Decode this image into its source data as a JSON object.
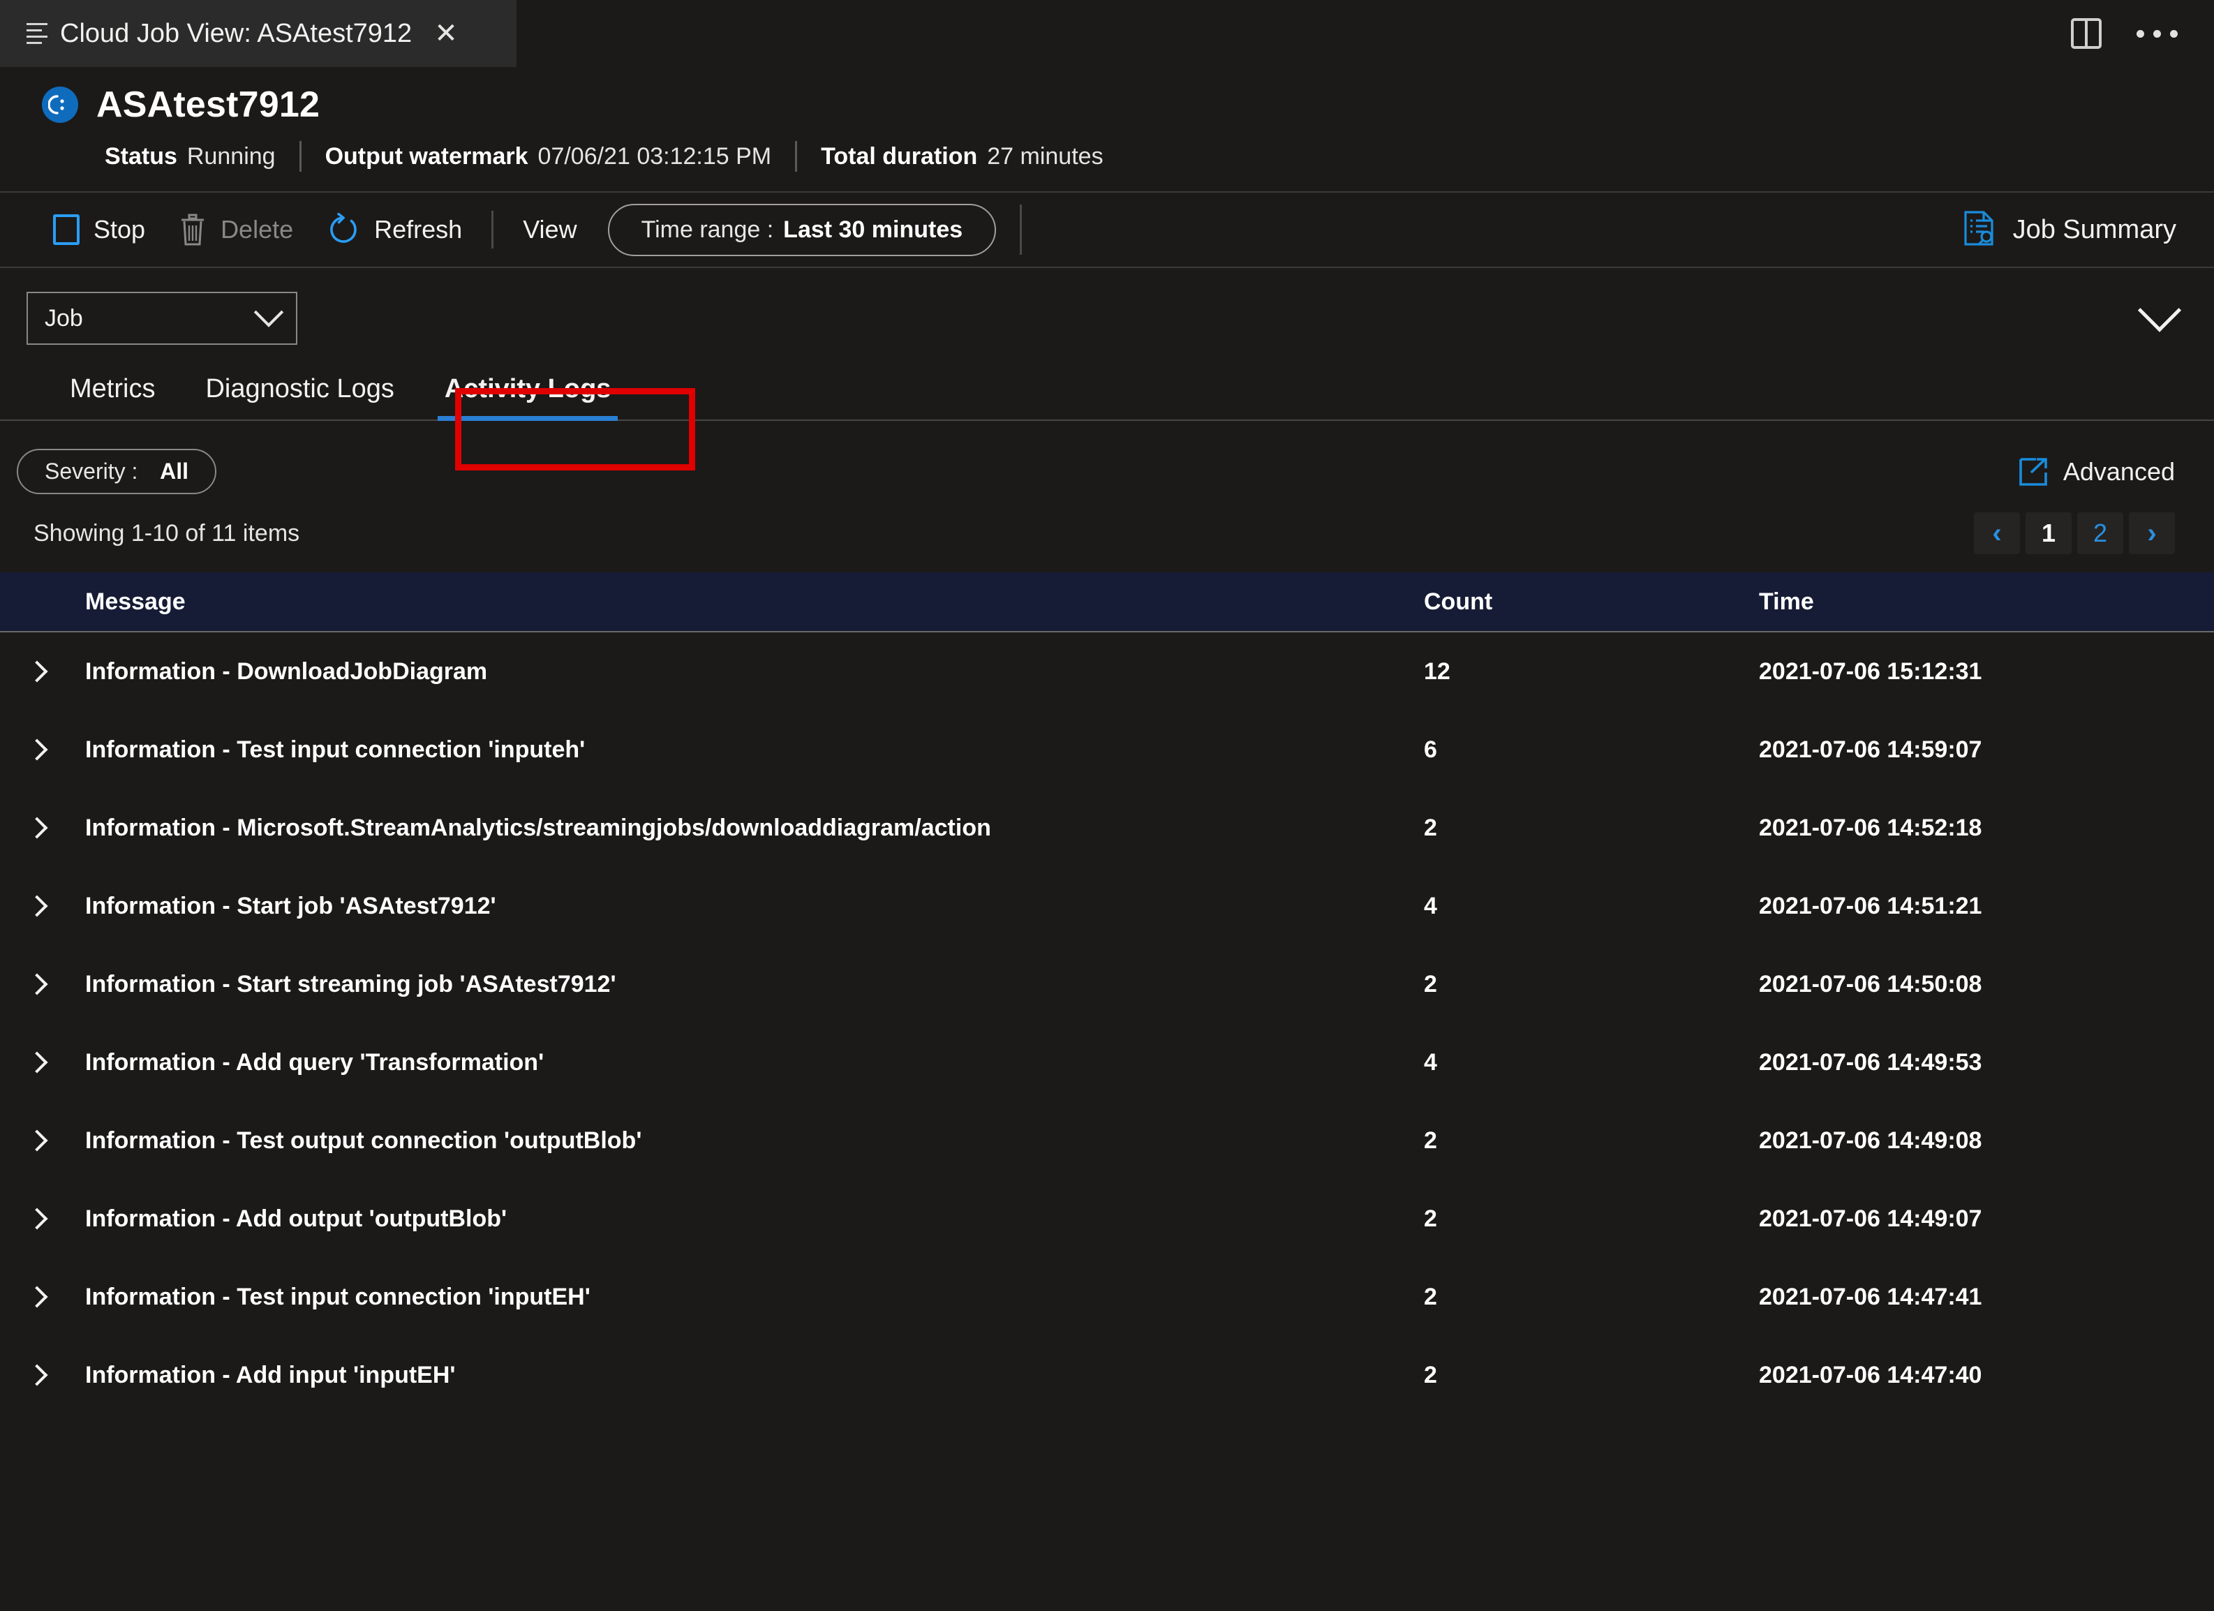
{
  "tabstrip": {
    "tab_title": "Cloud Job View: ASAtest7912",
    "close_label": "✕",
    "menu_icon": "hamburger-icon",
    "split_icon": "split-view-icon",
    "more_icon": "ellipsis-icon"
  },
  "job": {
    "name": "ASAtest7912",
    "status_key": "Status",
    "status_value": "Running",
    "watermark_key": "Output watermark",
    "watermark_value": "07/06/21 03:12:15 PM",
    "duration_key": "Total duration",
    "duration_value": "27 minutes"
  },
  "toolbar": {
    "stop_label": "Stop",
    "delete_label": "Delete",
    "refresh_label": "Refresh",
    "view_label": "View",
    "time_range_key": "Time range :",
    "time_range_value": "Last 30 minutes",
    "job_summary_label": "Job Summary"
  },
  "selector": {
    "scope_value": "Job",
    "collapse_icon": "chevron-down-icon"
  },
  "tabs": {
    "items": [
      {
        "label": "Metrics",
        "active": false
      },
      {
        "label": "Diagnostic Logs",
        "active": false
      },
      {
        "label": "Activity Logs",
        "active": true
      }
    ],
    "highlight_color": "#e00000",
    "active_underline_color": "#2a7fd4"
  },
  "filters": {
    "severity_key": "Severity :",
    "severity_value": "All",
    "advanced_label": "Advanced"
  },
  "results": {
    "showing_text": "Showing 1-10 of 11 items",
    "pager": {
      "prev_label": "‹",
      "next_label": "›",
      "pages": [
        "1",
        "2"
      ],
      "current_page": "1"
    }
  },
  "table": {
    "columns": [
      "Message",
      "Count",
      "Time"
    ],
    "header_bg": "#161c35",
    "rows": [
      {
        "message": "Information - DownloadJobDiagram",
        "count": "12",
        "time": "2021-07-06 15:12:31"
      },
      {
        "message": "Information - Test input connection 'inputeh'",
        "count": "6",
        "time": "2021-07-06 14:59:07"
      },
      {
        "message": "Information - Microsoft.StreamAnalytics/streamingjobs/downloaddiagram/action",
        "count": "2",
        "time": "2021-07-06 14:52:18"
      },
      {
        "message": "Information - Start job 'ASAtest7912'",
        "count": "4",
        "time": "2021-07-06 14:51:21"
      },
      {
        "message": "Information - Start streaming job 'ASAtest7912'",
        "count": "2",
        "time": "2021-07-06 14:50:08"
      },
      {
        "message": "Information - Add query 'Transformation'",
        "count": "4",
        "time": "2021-07-06 14:49:53"
      },
      {
        "message": "Information - Test output connection 'outputBlob'",
        "count": "2",
        "time": "2021-07-06 14:49:08"
      },
      {
        "message": "Information - Add output 'outputBlob'",
        "count": "2",
        "time": "2021-07-06 14:49:07"
      },
      {
        "message": "Information - Test input connection 'inputEH'",
        "count": "2",
        "time": "2021-07-06 14:47:41"
      },
      {
        "message": "Information - Add input 'inputEH'",
        "count": "2",
        "time": "2021-07-06 14:47:40"
      }
    ]
  }
}
